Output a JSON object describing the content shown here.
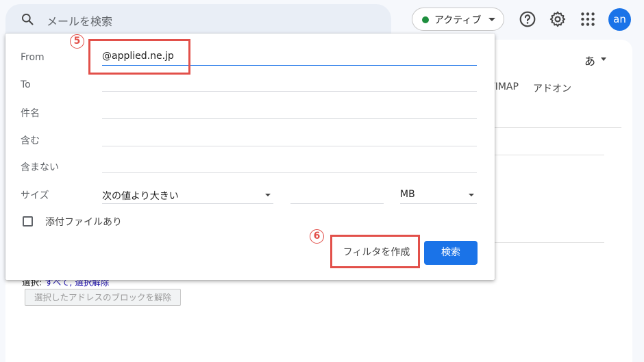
{
  "header": {
    "search_placeholder": "メールを検索",
    "status_label": "アクティブ",
    "avatar_initials": "an"
  },
  "background": {
    "language_label": "あ",
    "tab_imap": "/IMAP",
    "tab_addons": "アドオン",
    "select_prefix": "選択: ",
    "select_links": "すべて, 選択解除",
    "unblock_button": "選択したアドレスのブロックを解除"
  },
  "filter_dialog": {
    "from_label": "From",
    "from_value": "@applied.ne.jp",
    "to_label": "To",
    "subject_label": "件名",
    "includes_label": "含む",
    "excludes_label": "含まない",
    "size_label": "サイズ",
    "size_operator": "次の値より大きい",
    "size_unit": "MB",
    "attachment_label": "添付ファイルあり",
    "create_filter_button": "フィルタを作成",
    "search_button": "検索"
  },
  "callouts": {
    "step_5": "5",
    "step_6": "6"
  },
  "colors": {
    "accent_blue": "#1a73e8",
    "status_green": "#1e8e3e",
    "callout_red": "#e2504a"
  }
}
